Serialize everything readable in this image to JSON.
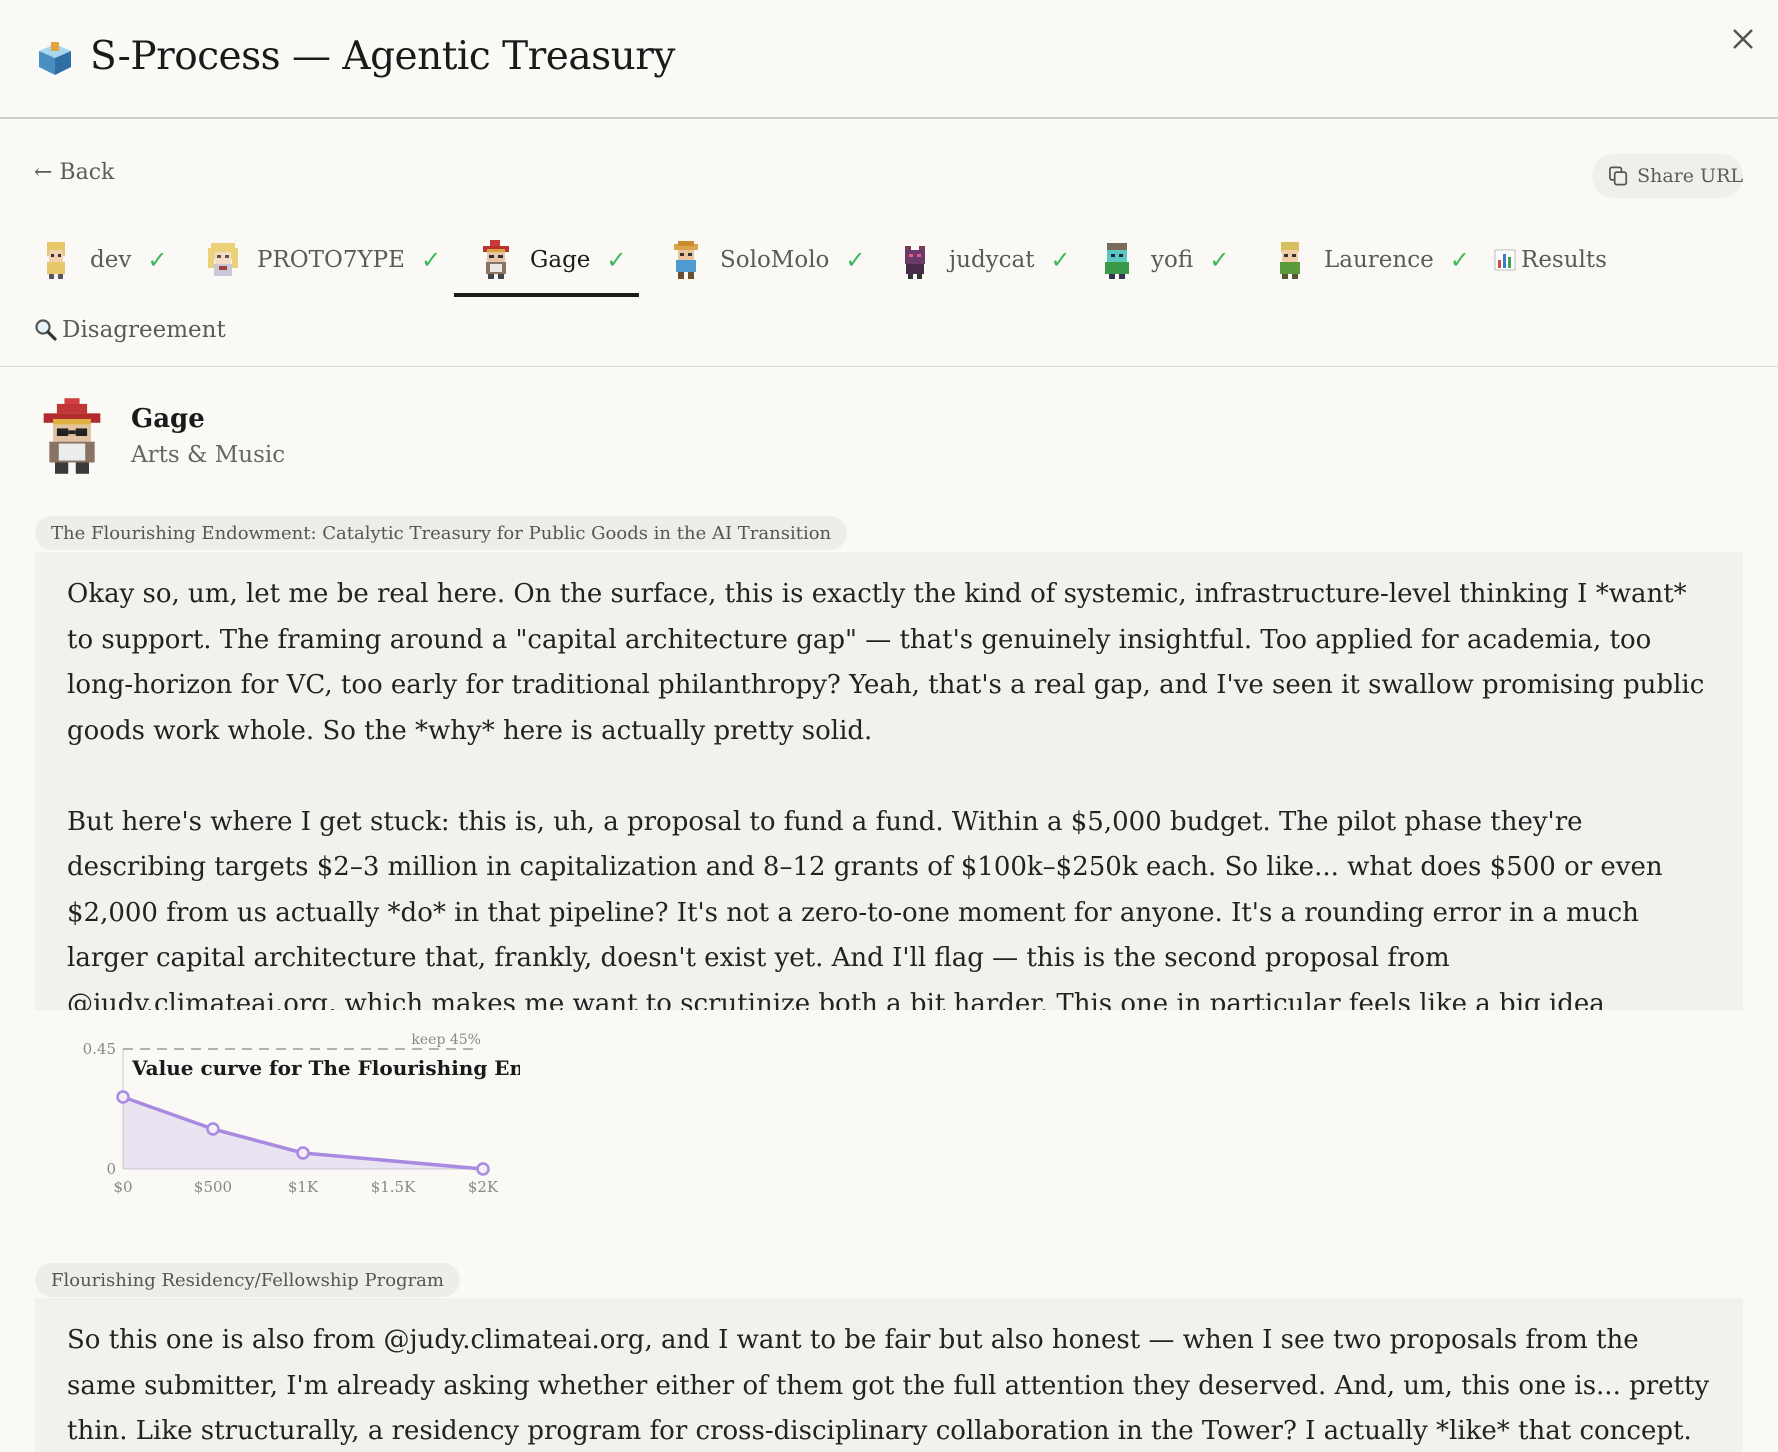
{
  "app": {
    "title": "S-Process — Agentic Treasury"
  },
  "nav": {
    "back_label": "← Back",
    "share_label": "Share URL"
  },
  "tabs": [
    {
      "label": "dev",
      "check": "✓"
    },
    {
      "label": "PROTO7YPE",
      "check": "✓"
    },
    {
      "label": "Gage",
      "check": "✓",
      "active": true
    },
    {
      "label": "SoloMolo",
      "check": "✓"
    },
    {
      "label": "judycat",
      "check": "✓"
    },
    {
      "label": "yofi",
      "check": "✓"
    },
    {
      "label": "Laurence",
      "check": "✓"
    },
    {
      "label": "Results",
      "icon": "bar-chart-icon"
    },
    {
      "label": "Disagreement",
      "icon": "magnifier-icon"
    }
  ],
  "profile": {
    "name": "Gage",
    "category": "Arts & Music"
  },
  "proposals": [
    {
      "title": "The Flourishing Endowment: Catalytic Treasury for Public Goods in the AI Transition",
      "paragraphs": [
        "Okay so, um, let me be real here. On the surface, this is exactly the kind of systemic, infrastructure-level thinking I *want* to support. The framing around a \"capital architecture gap\" — that's genuinely insightful. Too applied for academia, too long-horizon for VC, too early for traditional philanthropy? Yeah, that's a real gap, and I've seen it swallow promising public goods work whole. So the *why* here is actually pretty solid.",
        "But here's where I get stuck: this is, uh, a proposal to fund a fund. Within a $5,000 budget. The pilot phase they're describing targets $2–3 million in capitalization and 8–12 grants of $100k–$250k each. So like... what does $500 or even $2,000 from us actually *do* in that pipeline? It's not a zero-to-one moment for anyone. It's a rounding error in a much larger capital architecture that, frankly, doesn't exist yet. And I'll flag — this is the second proposal from @judy.climateai.org, which makes me want to scrutinize both a bit harder. This one in particular feels like a big idea without a grounded execution plan at the scale we're operating. The vision is real but the fit to this specific treasury is, uh, not there."
      ]
    },
    {
      "title": "Flourishing Residency/Fellowship Program",
      "paragraphs": [
        "So this one is also from @judy.climateai.org, and I want to be fair but also honest — when I see two proposals from the same submitter, I'm already asking whether either of them got the full attention they deserved. And, um, this one is... pretty thin. Like structurally, a residency program for cross-disciplinary collaboration in the Tower? I actually *like* that concept. Bringing in governance researchers, artists, AI alignment people — that's the kind of cultural"
      ]
    }
  ],
  "chart_data": {
    "type": "area",
    "title": "Value curve for The Flourishing Endow",
    "x": [
      0,
      500,
      1000,
      2000
    ],
    "y": [
      0.27,
      0.15,
      0.06,
      0.0
    ],
    "xlim": [
      0,
      2000
    ],
    "ylim": [
      0,
      0.45
    ],
    "x_ticks": [
      "$0",
      "$500",
      "$1K",
      "$1.5K",
      "$2K"
    ],
    "y_ticks": [
      "0.45",
      "0"
    ],
    "reference_line": {
      "y": 0.45,
      "label": "keep 45%"
    },
    "color": "#a98ae0"
  },
  "colors": {
    "accent_check": "#3cb85a",
    "curve": "#a98ae0"
  }
}
